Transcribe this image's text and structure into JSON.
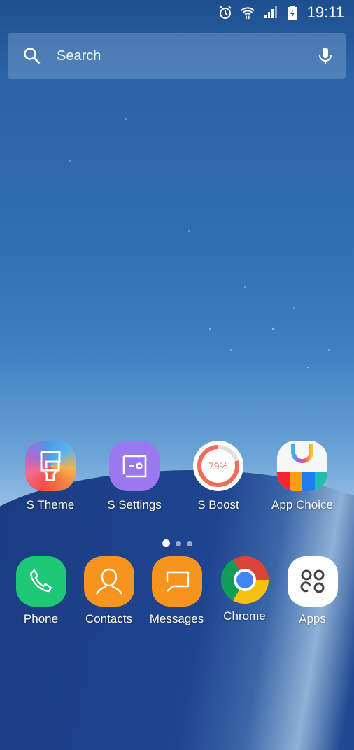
{
  "status_bar": {
    "time": "19:11",
    "icons": [
      "alarm-icon",
      "wifi-icon",
      "signal-icon",
      "battery-charging-icon"
    ]
  },
  "search": {
    "placeholder": "Search",
    "left_icon": "search-icon",
    "right_icon": "mic-icon"
  },
  "home_apps": [
    {
      "label": "S Theme",
      "icon": "paint-brush-icon"
    },
    {
      "label": "S Settings",
      "icon": "settings-panel-icon"
    },
    {
      "label": "S Boost",
      "icon": "boost-ring-icon",
      "percent_text": "79%",
      "progress": 0.79
    },
    {
      "label": "App Choice",
      "icon": "shopping-bag-icon"
    }
  ],
  "page_indicator": {
    "pages": 3,
    "current": 1
  },
  "dock": [
    {
      "label": "Phone",
      "icon": "phone-icon",
      "color": "#1fc877"
    },
    {
      "label": "Contacts",
      "icon": "contact-icon",
      "color": "#f7941d"
    },
    {
      "label": "Messages",
      "icon": "message-icon",
      "color": "#f7941d"
    },
    {
      "label": "Chrome",
      "icon": "chrome-icon"
    },
    {
      "label": "Apps",
      "icon": "apps-grid-icon",
      "color": "#ffffff"
    }
  ]
}
